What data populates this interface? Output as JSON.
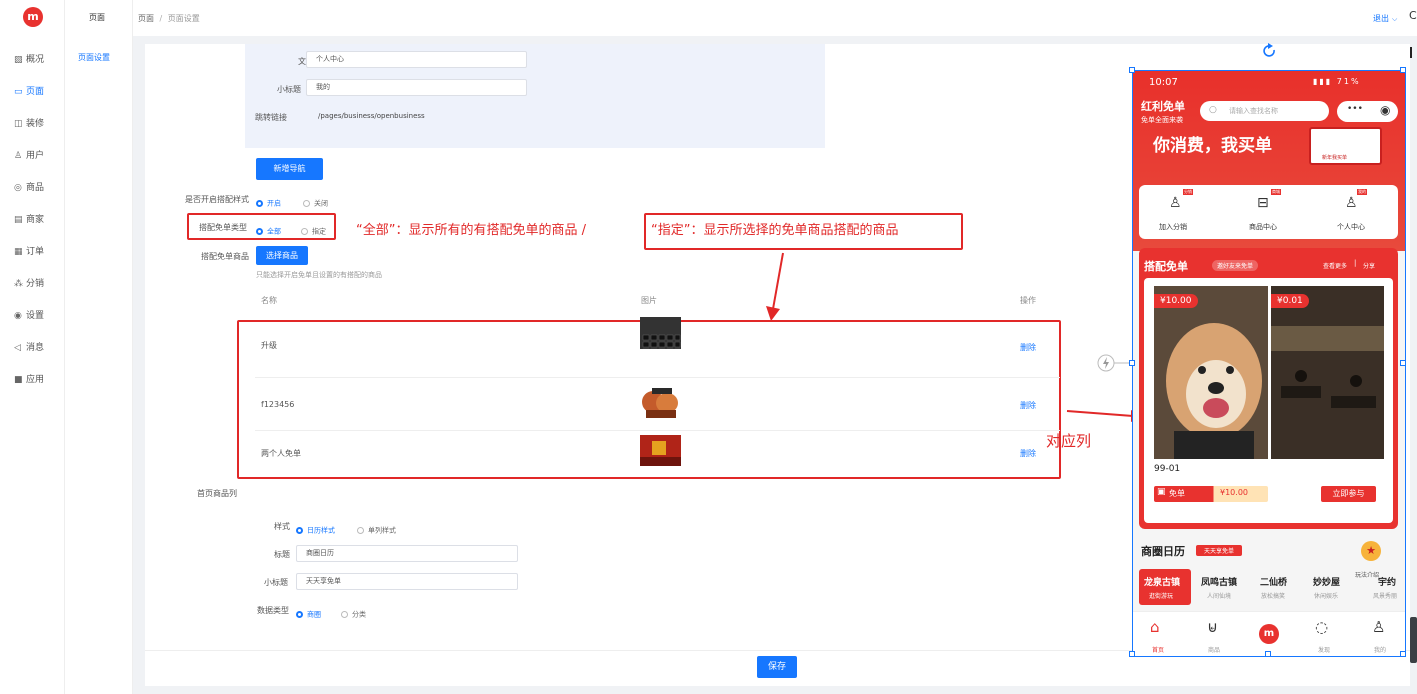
{
  "sidebar": {
    "logo_text": "m",
    "items": [
      {
        "label": "概况",
        "icon": "chart-icon",
        "glyph": "▧"
      },
      {
        "label": "页面",
        "icon": "page-icon",
        "glyph": "▭",
        "active": true
      },
      {
        "label": "装修",
        "icon": "decor-icon",
        "glyph": "◫"
      },
      {
        "label": "用户",
        "icon": "user-icon",
        "glyph": "♙"
      },
      {
        "label": "商品",
        "icon": "goods-icon",
        "glyph": "◎"
      },
      {
        "label": "商家",
        "icon": "shop-icon",
        "glyph": "▤"
      },
      {
        "label": "订单",
        "icon": "order-icon",
        "glyph": "▦"
      },
      {
        "label": "分销",
        "icon": "share-icon",
        "glyph": "⁂"
      },
      {
        "label": "设置",
        "icon": "settings-icon",
        "glyph": "◉"
      },
      {
        "label": "消息",
        "icon": "message-icon",
        "glyph": "◁"
      },
      {
        "label": "应用",
        "icon": "apps-icon",
        "glyph": "■"
      }
    ]
  },
  "subnav": {
    "title": "页面",
    "item": "页面设置"
  },
  "header": {
    "breadcrumb_root": "页面",
    "breadcrumb_sep": "/",
    "breadcrumb_current": "页面设置",
    "logout": "退出",
    "edge_char": "C"
  },
  "nav_form": {
    "text_label": "文字",
    "text_value": "个人中心",
    "subtitle_label": "小标题",
    "subtitle_value": "我的",
    "link_label": "跳转链接",
    "link_value": "/pages/business/openbusiness"
  },
  "add_nav_button": "新增导航",
  "collocation_style": {
    "label": "是否开启搭配样式",
    "options": [
      "开启",
      "关闭"
    ],
    "selected": 0
  },
  "free_type": {
    "label": "搭配免单类型",
    "options": [
      "全部",
      "指定"
    ],
    "selected": 0
  },
  "annotation_all": "“全部”：显示所有的有搭配免单的商品 /",
  "annotation_specified": "“指定”：显示所选择的免单商品搭配的商品",
  "free_goods": {
    "label": "搭配免单商品",
    "button": "选择商品",
    "hint": "只能选择开启免单且设置的有搭配的商品"
  },
  "table": {
    "headers": [
      "名称",
      "图片",
      "操作"
    ],
    "rows": [
      {
        "name": "升级",
        "action": "删除"
      },
      {
        "name": "f123456",
        "action": "删除"
      },
      {
        "name": "两个人免单",
        "action": "删除"
      }
    ]
  },
  "annotation_column": "对应列",
  "home_list": {
    "label": "首页商品列",
    "style_label": "样式",
    "style_options": [
      "日历样式",
      "单列样式"
    ],
    "style_selected": 0,
    "title_label": "标题",
    "title_value": "商圈日历",
    "subtitle_label": "小标题",
    "subtitle_value": "天天享免单",
    "datatype_label": "数据类型",
    "datatype_options": [
      "商圈",
      "分类"
    ],
    "datatype_selected": 0
  },
  "save_button": "保存",
  "phone": {
    "status_time": "10:07",
    "status_right": "71%",
    "brand": "红利免单",
    "brand_sub": "免单全面来袭",
    "search_placeholder": "请输入查找名称",
    "menu_dots": "•••",
    "banner_text": "你消费，我买单",
    "banner_tag": "新年我买单",
    "quick": [
      {
        "label": "加入分销",
        "badge": "分销",
        "icon": "distribution-icon"
      },
      {
        "label": "商品中心",
        "badge": "商城",
        "icon": "store-icon"
      },
      {
        "label": "个人中心",
        "badge": "我的",
        "icon": "person-icon"
      }
    ],
    "free": {
      "title": "搭配免单",
      "tag": "邀好友来免单",
      "more": "查看更多",
      "share": "分享",
      "cards": [
        {
          "price": "¥10.00"
        },
        {
          "price": "¥0.01"
        }
      ],
      "item_name": "99-01",
      "free_label": "免单",
      "free_price": "¥10.00",
      "join": "立即参与"
    },
    "calendar": {
      "title": "商圈日历",
      "tag": "天天享免单",
      "play": "玩法介绍",
      "items": [
        {
          "name": "龙泉古镇",
          "sub": "逛街游玩",
          "active": true
        },
        {
          "name": "凤鸣古镇",
          "sub": "人间仙境"
        },
        {
          "name": "二仙桥",
          "sub": "放松搞笑"
        },
        {
          "name": "妙妙屋",
          "sub": "休闲娱乐"
        },
        {
          "name": "宇约",
          "sub": "风景秀丽"
        }
      ]
    },
    "tabs": [
      {
        "label": "首页",
        "icon": "home-icon"
      },
      {
        "label": "商品",
        "icon": "bag-icon"
      },
      {
        "label": "",
        "icon": "brand-logo-icon"
      },
      {
        "label": "发现",
        "icon": "chat-icon"
      },
      {
        "label": "我的",
        "icon": "profile-icon"
      }
    ]
  },
  "colors": {
    "accent": "#1677ff",
    "brand_red": "#e8322f",
    "annotation_red": "#e12828"
  }
}
